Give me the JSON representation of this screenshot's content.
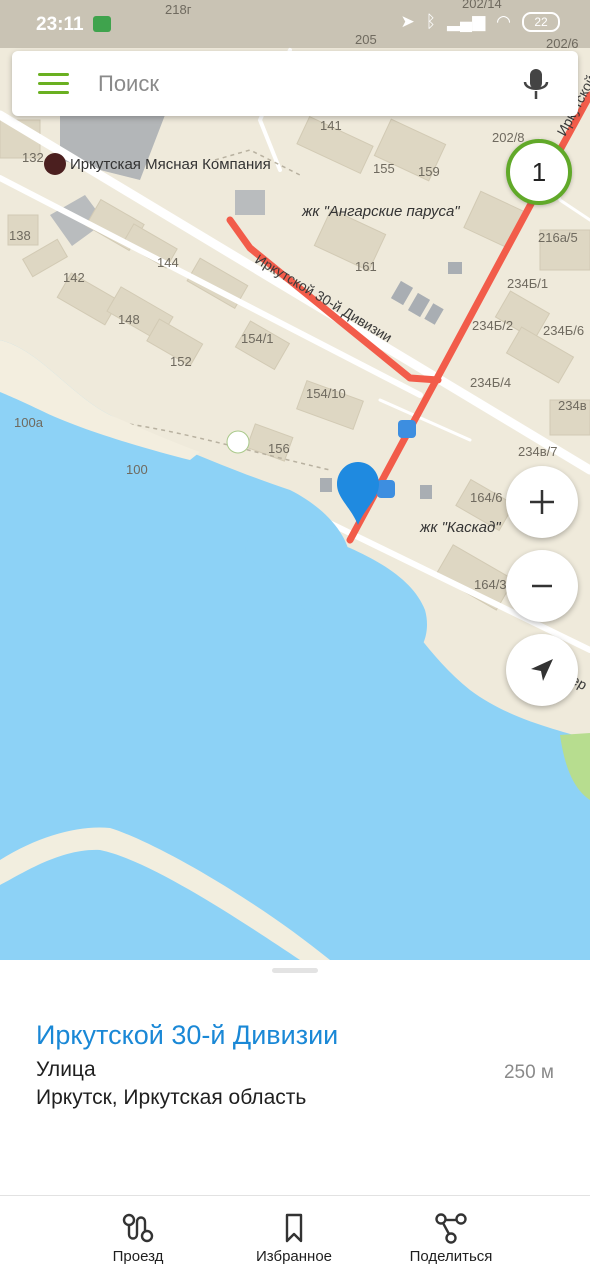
{
  "status_bar": {
    "time": "23:11",
    "battery": "22",
    "icons": [
      "location-icon",
      "bluetooth-icon",
      "signal-icon",
      "wifi-icon"
    ]
  },
  "search": {
    "placeholder": "Поиск"
  },
  "route_badge": "1",
  "map": {
    "labels": {
      "myasnaya": "Иркутская Мясная Компания",
      "angarskie": "жк \"Ангарские паруса\"",
      "kaskad": "жк \"Каскад\"",
      "street": "Иркутской 30-й Дивизии",
      "street_cut": "Иркутской",
      "ber": "Бер",
      "n218g": "218г",
      "n205": "205",
      "n202_14": "202/14",
      "n202_6": "202/6",
      "n141": "141",
      "n155": "155",
      "n159": "159",
      "n202_8": "202/8",
      "n132": "132",
      "n138": "138",
      "n216a5": "216а/5",
      "n142": "142",
      "n144": "144",
      "n161": "161",
      "n234b1": "234Б/1",
      "n148": "148",
      "n154_1": "154/1",
      "n234b2": "234Б/2",
      "n234b6": "234Б/6",
      "n152": "152",
      "n234b4": "234Б/4",
      "n234v": "234в",
      "n154_10": "154/10",
      "n100a": "100а",
      "n156": "156",
      "n234v7": "234в/7",
      "n100": "100",
      "n164_6": "164/6",
      "n164_3": "164/3"
    }
  },
  "place": {
    "title": "Иркутской 30-й Дивизии",
    "type": "Улица",
    "distance": "250 м",
    "address": "Иркутск, Иркутская область"
  },
  "nav": {
    "route": "Проезд",
    "favorites": "Избранное",
    "share": "Поделиться"
  },
  "colors": {
    "water": "#8dd2f6",
    "land": "#efeadb",
    "route": "#f25c4a",
    "accent_green": "#61a929",
    "title_blue": "#1a88d6"
  }
}
